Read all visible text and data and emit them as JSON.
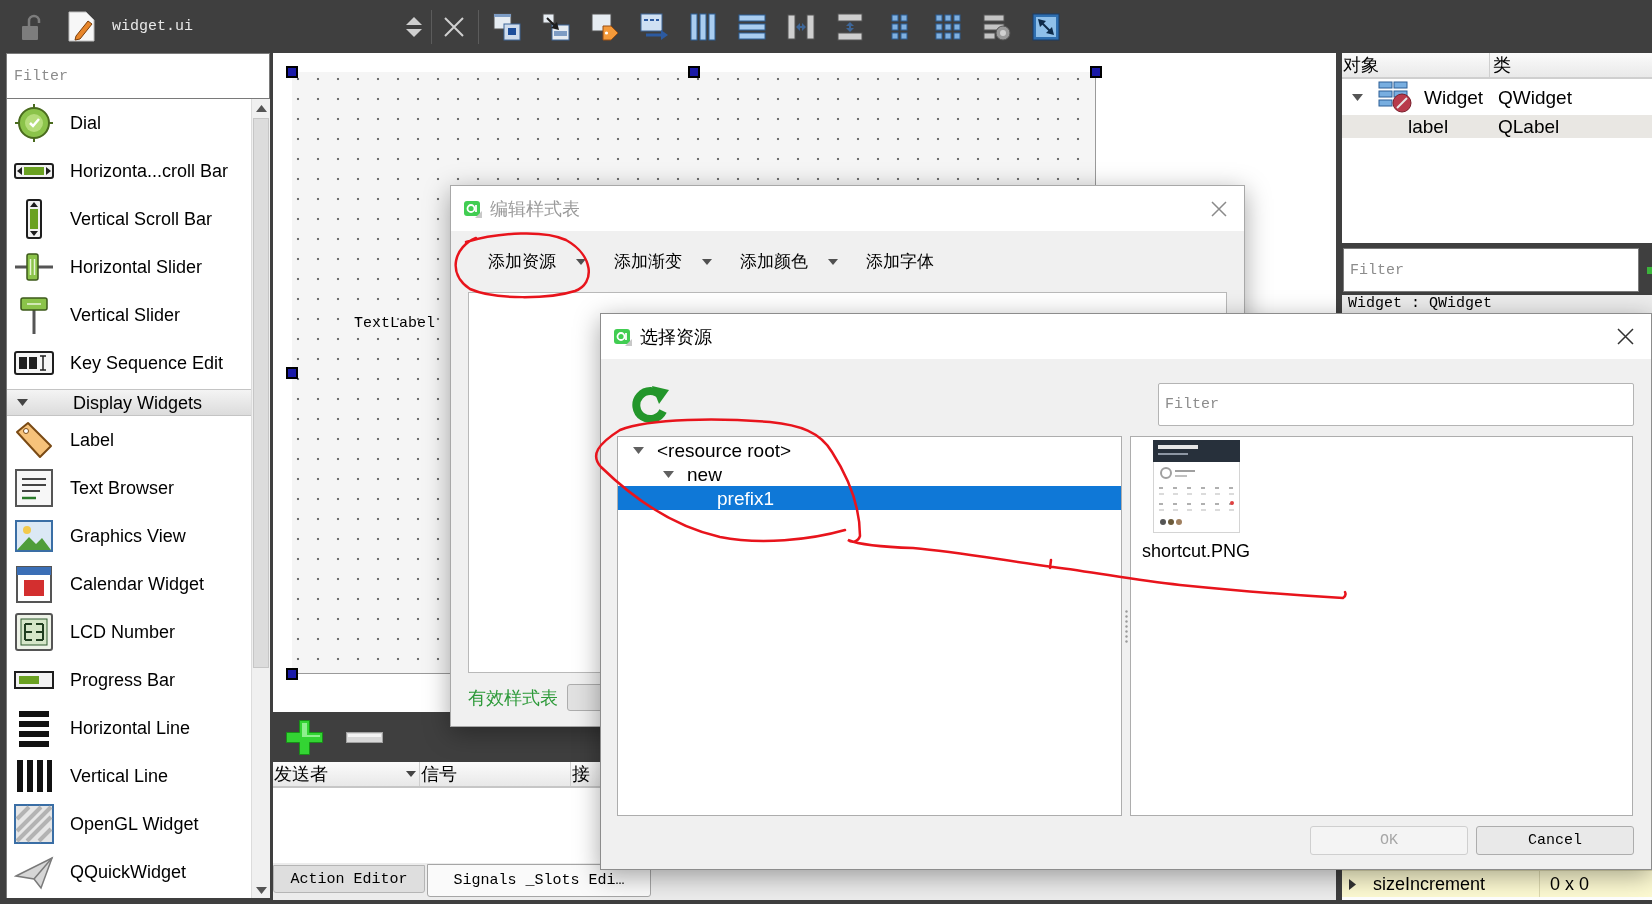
{
  "toolbar": {
    "file_name": "widget.ui"
  },
  "widget_box": {
    "filter": {
      "placeholder": "Filter"
    },
    "items": [
      {
        "kind": "widget",
        "label": "Dial"
      },
      {
        "kind": "widget",
        "label": "Horizonta...croll Bar"
      },
      {
        "kind": "widget",
        "label": "Vertical Scroll Bar"
      },
      {
        "kind": "widget",
        "label": "Horizontal Slider"
      },
      {
        "kind": "widget",
        "label": "Vertical Slider"
      },
      {
        "kind": "widget",
        "label": "Key Sequence Edit"
      },
      {
        "kind": "category",
        "label": "Display Widgets",
        "expanded": true
      },
      {
        "kind": "widget",
        "label": "Label"
      },
      {
        "kind": "widget",
        "label": "Text Browser"
      },
      {
        "kind": "widget",
        "label": "Graphics View"
      },
      {
        "kind": "widget",
        "label": "Calendar Widget"
      },
      {
        "kind": "widget",
        "label": "LCD Number"
      },
      {
        "kind": "widget",
        "label": "Progress Bar"
      },
      {
        "kind": "widget",
        "label": "Horizontal Line"
      },
      {
        "kind": "widget",
        "label": "Vertical Line"
      },
      {
        "kind": "widget",
        "label": "OpenGL Widget"
      },
      {
        "kind": "widget",
        "label": "QQuickWidget"
      }
    ]
  },
  "form": {
    "label_text": "TextLabel"
  },
  "signal_slot_editor": {
    "columns": [
      {
        "label": "发送者",
        "sorted": true
      },
      {
        "label": "信号",
        "sorted": false
      },
      {
        "label": "接"
      }
    ],
    "tabs": [
      {
        "label": "Action Editor",
        "selected": false
      },
      {
        "label": "Signals _Slots Edi…",
        "selected": true
      }
    ]
  },
  "object_inspector": {
    "columns": [
      "对象",
      "类"
    ],
    "tree": [
      {
        "object": "Widget",
        "class": "QWidget",
        "expanded": true,
        "children": [
          {
            "object": "label",
            "class": "QLabel"
          }
        ]
      }
    ]
  },
  "property_editor": {
    "filter": {
      "placeholder": "Filter"
    },
    "header": "Widget : QWidget",
    "rows": [
      {
        "name": "sizeIncrement",
        "value": "0 x 0",
        "expanded": false
      }
    ]
  },
  "stylesheet_dialog": {
    "title": "编辑样式表",
    "active": false,
    "actions": [
      {
        "label": "添加资源",
        "menu": true
      },
      {
        "label": "添加渐变",
        "menu": true
      },
      {
        "label": "添加颜色",
        "menu": true
      },
      {
        "label": "添加字体",
        "menu": false
      }
    ],
    "status": {
      "text": "有效样式表",
      "valid": true
    }
  },
  "resource_dialog": {
    "title": "选择资源",
    "active": true,
    "filter": {
      "placeholder": "Filter"
    },
    "tree": [
      {
        "label": "<resource root>",
        "expanded": true,
        "selected": false,
        "children": [
          {
            "label": "new",
            "expanded": true,
            "selected": false,
            "children": [
              {
                "label": "prefix1",
                "selected": true
              }
            ]
          }
        ]
      }
    ],
    "files": [
      {
        "name": "shortcut.PNG"
      }
    ],
    "buttons": [
      {
        "label": "OK",
        "disabled": true
      },
      {
        "label": "Cancel",
        "disabled": false
      }
    ]
  }
}
